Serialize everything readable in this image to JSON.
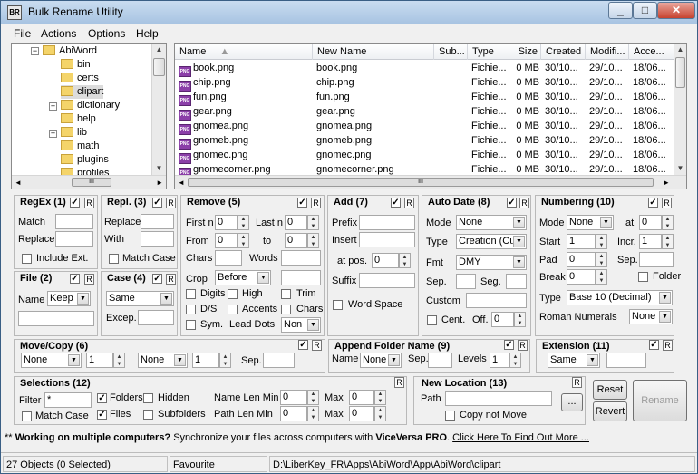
{
  "window": {
    "title": "Bulk Rename Utility",
    "app_icon": "BR",
    "minimize": "_",
    "maximize": "□",
    "close": "✕"
  },
  "menu": {
    "file": "File",
    "actions": "Actions",
    "options": "Options",
    "help": "Help"
  },
  "tree": {
    "root": "AbiWord",
    "items": [
      "bin",
      "certs",
      "clipart",
      "dictionary",
      "help",
      "lib",
      "math",
      "plugins",
      "profiles"
    ]
  },
  "filelist": {
    "columns": [
      "Name",
      "New Name",
      "Sub...",
      "Type",
      "Size",
      "Created",
      "Modifi...",
      "Acce..."
    ],
    "rows": [
      {
        "name": "book.png",
        "new": "book.png",
        "type": "Fichie...",
        "size": "0 MB",
        "created": "30/10...",
        "modified": "29/10...",
        "accessed": "18/06..."
      },
      {
        "name": "chip.png",
        "new": "chip.png",
        "type": "Fichie...",
        "size": "0 MB",
        "created": "30/10...",
        "modified": "29/10...",
        "accessed": "18/06..."
      },
      {
        "name": "fun.png",
        "new": "fun.png",
        "type": "Fichie...",
        "size": "0 MB",
        "created": "30/10...",
        "modified": "29/10...",
        "accessed": "18/06..."
      },
      {
        "name": "gear.png",
        "new": "gear.png",
        "type": "Fichie...",
        "size": "0 MB",
        "created": "30/10...",
        "modified": "29/10...",
        "accessed": "18/06..."
      },
      {
        "name": "gnomea.png",
        "new": "gnomea.png",
        "type": "Fichie...",
        "size": "0 MB",
        "created": "30/10...",
        "modified": "29/10...",
        "accessed": "18/06..."
      },
      {
        "name": "gnomeb.png",
        "new": "gnomeb.png",
        "type": "Fichie...",
        "size": "0 MB",
        "created": "30/10...",
        "modified": "29/10...",
        "accessed": "18/06..."
      },
      {
        "name": "gnomec.png",
        "new": "gnomec.png",
        "type": "Fichie...",
        "size": "0 MB",
        "created": "30/10...",
        "modified": "29/10...",
        "accessed": "18/06..."
      },
      {
        "name": "gnomecorner.png",
        "new": "gnomecorner.png",
        "type": "Fichie...",
        "size": "0 MB",
        "created": "30/10...",
        "modified": "29/10...",
        "accessed": "18/06..."
      }
    ]
  },
  "regex": {
    "title": "RegEx (1)",
    "match": "Match",
    "replace": "Replace",
    "include_ext": "Include Ext."
  },
  "repl": {
    "title": "Repl. (3)",
    "replace": "Replace",
    "with": "With",
    "match_case": "Match Case"
  },
  "remove": {
    "title": "Remove (5)",
    "first_n": "First n",
    "last_n": "Last n",
    "from": "From",
    "to": "to",
    "chars": "Chars",
    "words": "Words",
    "crop": "Crop",
    "crop_val": "Before",
    "digits": "Digits",
    "high": "High",
    "trim": "Trim",
    "ds": "D/S",
    "accents": "Accents",
    "chars_chk": "Chars",
    "sym": "Sym.",
    "lead_dots": "Lead Dots",
    "lead_val": "Non",
    "zero": "0"
  },
  "add": {
    "title": "Add (7)",
    "prefix": "Prefix",
    "insert": "Insert",
    "at_pos": "at pos.",
    "suffix": "Suffix",
    "word_space": "Word Space",
    "zero": "0"
  },
  "autodate": {
    "title": "Auto Date (8)",
    "mode": "Mode",
    "mode_val": "None",
    "type": "Type",
    "type_val": "Creation (Cur",
    "fmt": "Fmt",
    "fmt_val": "DMY",
    "sep": "Sep.",
    "seg": "Seg.",
    "custom": "Custom",
    "cent": "Cent.",
    "off": "Off.",
    "zero": "0"
  },
  "numbering": {
    "title": "Numbering (10)",
    "mode": "Mode",
    "mode_val": "None",
    "at": "at",
    "at_val": "0",
    "start": "Start",
    "start_val": "1",
    "incr": "Incr.",
    "incr_val": "1",
    "pad": "Pad",
    "pad_val": "0",
    "sep": "Sep.",
    "break": "Break",
    "break_val": "0",
    "folder": "Folder",
    "type": "Type",
    "type_val": "Base 10 (Decimal)",
    "roman": "Roman Numerals",
    "roman_val": "None"
  },
  "file": {
    "title": "File (2)",
    "name": "Name",
    "name_val": "Keep"
  },
  "case": {
    "title": "Case (4)",
    "case_val": "Same",
    "excep": "Excep."
  },
  "movecopy": {
    "title": "Move/Copy (6)",
    "mode_val": "None",
    "n1": "1",
    "mode2_val": "None",
    "n2": "1",
    "sep": "Sep."
  },
  "appendfolder": {
    "title": "Append Folder Name (9)",
    "name": "Name",
    "name_val": "None",
    "sep": "Sep.",
    "levels": "Levels",
    "levels_val": "1"
  },
  "extension": {
    "title": "Extension (11)",
    "val": "Same"
  },
  "selections": {
    "title": "Selections (12)",
    "filter": "Filter",
    "filter_val": "*",
    "folders": "Folders",
    "hidden": "Hidden",
    "name_len_min": "Name Len Min",
    "name_len_min_val": "0",
    "max": "Max",
    "max1_val": "0",
    "match_case": "Match Case",
    "files": "Files",
    "subfolders": "Subfolders",
    "path_len_min": "Path Len Min",
    "path_len_min_val": "0",
    "max2_val": "0"
  },
  "newlocation": {
    "title": "New Location (13)",
    "path": "Path",
    "browse": "...",
    "copy_not_move": "Copy not Move"
  },
  "buttons": {
    "reset": "Reset",
    "revert": "Revert",
    "rename": "Rename"
  },
  "promo": {
    "prefix": "** ",
    "bold1": "Working on multiple computers?",
    "mid": " Synchronize your files across computers with ",
    "bold2": "ViceVersa PRO",
    "end": ". ",
    "link": "Click Here To Find Out More ..."
  },
  "status": {
    "objects": "27 Objects (0 Selected)",
    "favourite": "Favourite",
    "path": "D:\\LiberKey_FR\\Apps\\AbiWord\\App\\AbiWord\\clipart"
  },
  "glyphs": {
    "r": "R",
    "check": "✓",
    "up": "▲",
    "down": "▼",
    "left": "◄",
    "right": "►",
    "grip": "III",
    "dd": "▼",
    "plus": "+",
    "minus": "−"
  }
}
